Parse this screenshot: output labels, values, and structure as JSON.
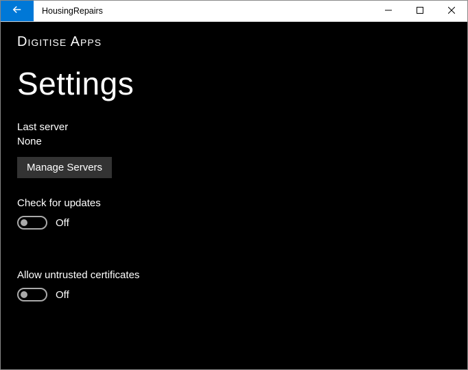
{
  "window": {
    "title": "HousingRepairs"
  },
  "brand": "Digitise Apps",
  "page_title": "Settings",
  "last_server": {
    "label": "Last server",
    "value": "None",
    "manage_label": "Manage Servers"
  },
  "updates": {
    "label": "Check for updates",
    "state": "Off"
  },
  "certificates": {
    "label": "Allow untrusted certificates",
    "state": "Off"
  }
}
